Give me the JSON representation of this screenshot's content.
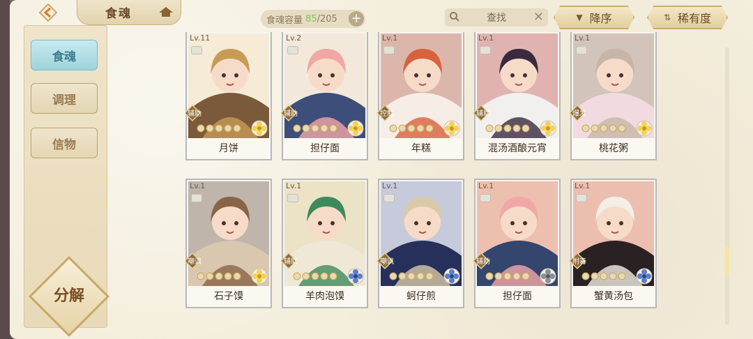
{
  "header": {
    "title": "食魂",
    "capacity_label": "食魂容量",
    "capacity_current": "85",
    "capacity_max": "/205",
    "search_label": "查找",
    "sort_desc_label": "降序",
    "sort_rare_label": "稀有度"
  },
  "sidebar": {
    "tabs": [
      {
        "label": "食魂",
        "active": true
      },
      {
        "label": "调理",
        "active": false
      },
      {
        "label": "信物",
        "active": false
      }
    ],
    "decompose_label": "分解"
  },
  "cards": [
    {
      "level": "Lv.11",
      "name": "月饼",
      "role": "辅助",
      "element": "gold",
      "palette": [
        "#c89b55",
        "#7a5a3a",
        "#f0d9a8"
      ]
    },
    {
      "level": "Lv.2",
      "name": "担仔面",
      "role": "辅助",
      "element": "gold",
      "palette": [
        "#f2a7a7",
        "#3d4e7a",
        "#e9d3b8"
      ]
    },
    {
      "level": "Lv.1",
      "name": "年糕",
      "role": "控制",
      "element": "gold",
      "palette": [
        "#d8623c",
        "#f5ede6",
        "#a8422d"
      ]
    },
    {
      "level": "Lv.1",
      "name": "混汤酒酿元宵",
      "role": "辅助",
      "element": "gold",
      "palette": [
        "#3a2a40",
        "#f2f0ee",
        "#b8383c"
      ]
    },
    {
      "level": "Lv.1",
      "name": "桃花粥",
      "role": "爆发",
      "element": "gold",
      "palette": [
        "#c7b6a8",
        "#f1dbe0",
        "#8d6a5a"
      ]
    },
    {
      "level": "Lv.1",
      "name": "石子馍",
      "role": "嘲讽",
      "element": "gold",
      "palette": [
        "#8a6446",
        "#d9c7b0",
        "#5a3e2e"
      ]
    },
    {
      "level": "Lv.1",
      "name": "羊肉泡馍",
      "role": "辅助",
      "element": "blue",
      "palette": [
        "#3f8a5a",
        "#efe8d6",
        "#d8c07a"
      ]
    },
    {
      "level": "Lv.1",
      "name": "蚵仔煎",
      "role": "嘲讽",
      "element": "blue",
      "palette": [
        "#d9c9a8",
        "#27305a",
        "#6b7ab8"
      ]
    },
    {
      "level": "Lv.1",
      "name": "担仔面",
      "role": "辅助",
      "element": "gray",
      "palette": [
        "#f2a7a7",
        "#34456e",
        "#d95d3a"
      ]
    },
    {
      "level": "Lv.1",
      "name": "蟹黄汤包",
      "role": "附毒",
      "element": "blue",
      "palette": [
        "#f3eee6",
        "#2a2222",
        "#d85a3a"
      ]
    }
  ]
}
